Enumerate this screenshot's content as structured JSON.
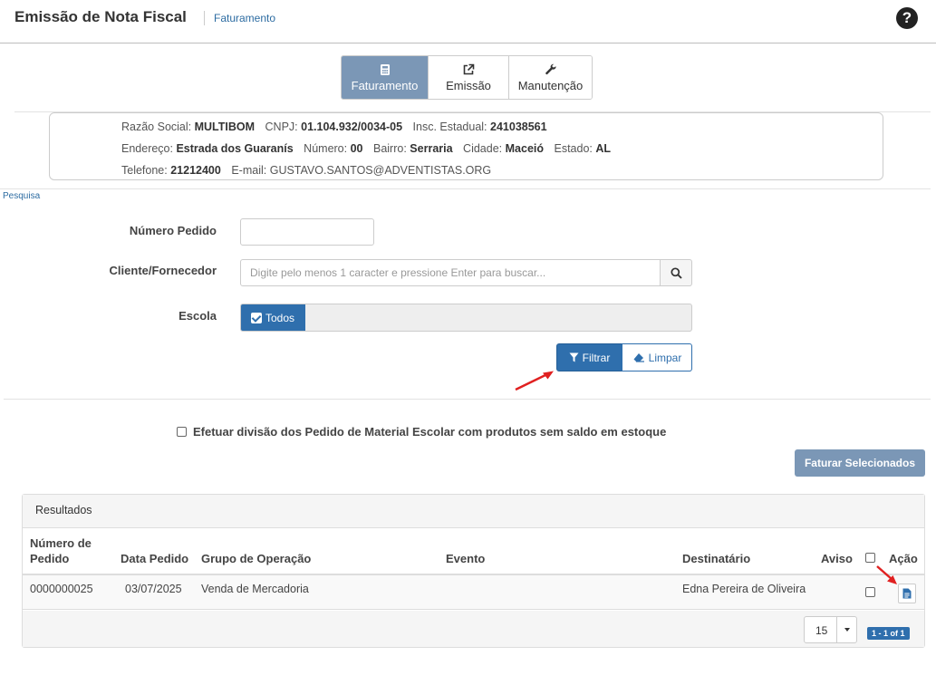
{
  "header": {
    "title": "Emissão de Nota Fiscal",
    "breadcrumb": "Faturamento",
    "help_icon": "question-circle-icon"
  },
  "tabs": [
    {
      "label": "Faturamento",
      "icon": "calculator-icon",
      "active": true
    },
    {
      "label": "Emissão",
      "icon": "external-link-icon",
      "active": false
    },
    {
      "label": "Manutenção",
      "icon": "wrench-icon",
      "active": false
    }
  ],
  "company": {
    "razao_label": "Razão Social:",
    "razao": "MULTIBOM",
    "cnpj_label": "CNPJ:",
    "cnpj": "01.104.932/0034-05",
    "ie_label": "Insc. Estadual:",
    "ie": "241038561",
    "endereco_label": "Endereço:",
    "endereco": "Estrada dos Guaranís",
    "numero_label": "Número:",
    "numero": "00",
    "bairro_label": "Bairro:",
    "bairro": "Serraria",
    "cidade_label": "Cidade:",
    "cidade": "Maceió",
    "estado_label": "Estado:",
    "estado": "AL",
    "telefone_label": "Telefone:",
    "telefone": "21212400",
    "email_label": "E-mail:",
    "email": "GUSTAVO.SANTOS@ADVENTISTAS.ORG"
  },
  "search": {
    "section_label": "Pesquisa",
    "numero_pedido_label": "Número Pedido",
    "numero_pedido_value": "",
    "cliente_label": "Cliente/Fornecedor",
    "cliente_placeholder": "Digite pelo menos 1 caracter e pressione Enter para buscar...",
    "escola_label": "Escola",
    "escola_selected": "Todos",
    "filtrar_label": "Filtrar",
    "limpar_label": "Limpar"
  },
  "options": {
    "divisao_label": "Efetuar divisão dos Pedido de Material Escolar com produtos sem saldo em estoque",
    "divisao_checked": false,
    "faturar_label": "Faturar Selecionados"
  },
  "results": {
    "title": "Resultados",
    "columns": {
      "numero_l1": "Número de",
      "numero_l2": "Pedido",
      "data": "Data Pedido",
      "grupo": "Grupo de Operação",
      "evento": "Evento",
      "destinatario": "Destinatário",
      "aviso": "Aviso",
      "acao": "Ação"
    },
    "rows": [
      {
        "numero": "0000000025",
        "data": "03/07/2025",
        "grupo": "Venda de Mercadoria",
        "evento": "",
        "destinatario": "Edna Pereira de Oliveira",
        "aviso": "",
        "checked": false
      }
    ],
    "page_size": "15",
    "pager": "1 - 1 of 1"
  },
  "colors": {
    "primary": "#2f6fad",
    "muted_primary": "#7b97b6",
    "annotation_arrow": "#e02020"
  }
}
